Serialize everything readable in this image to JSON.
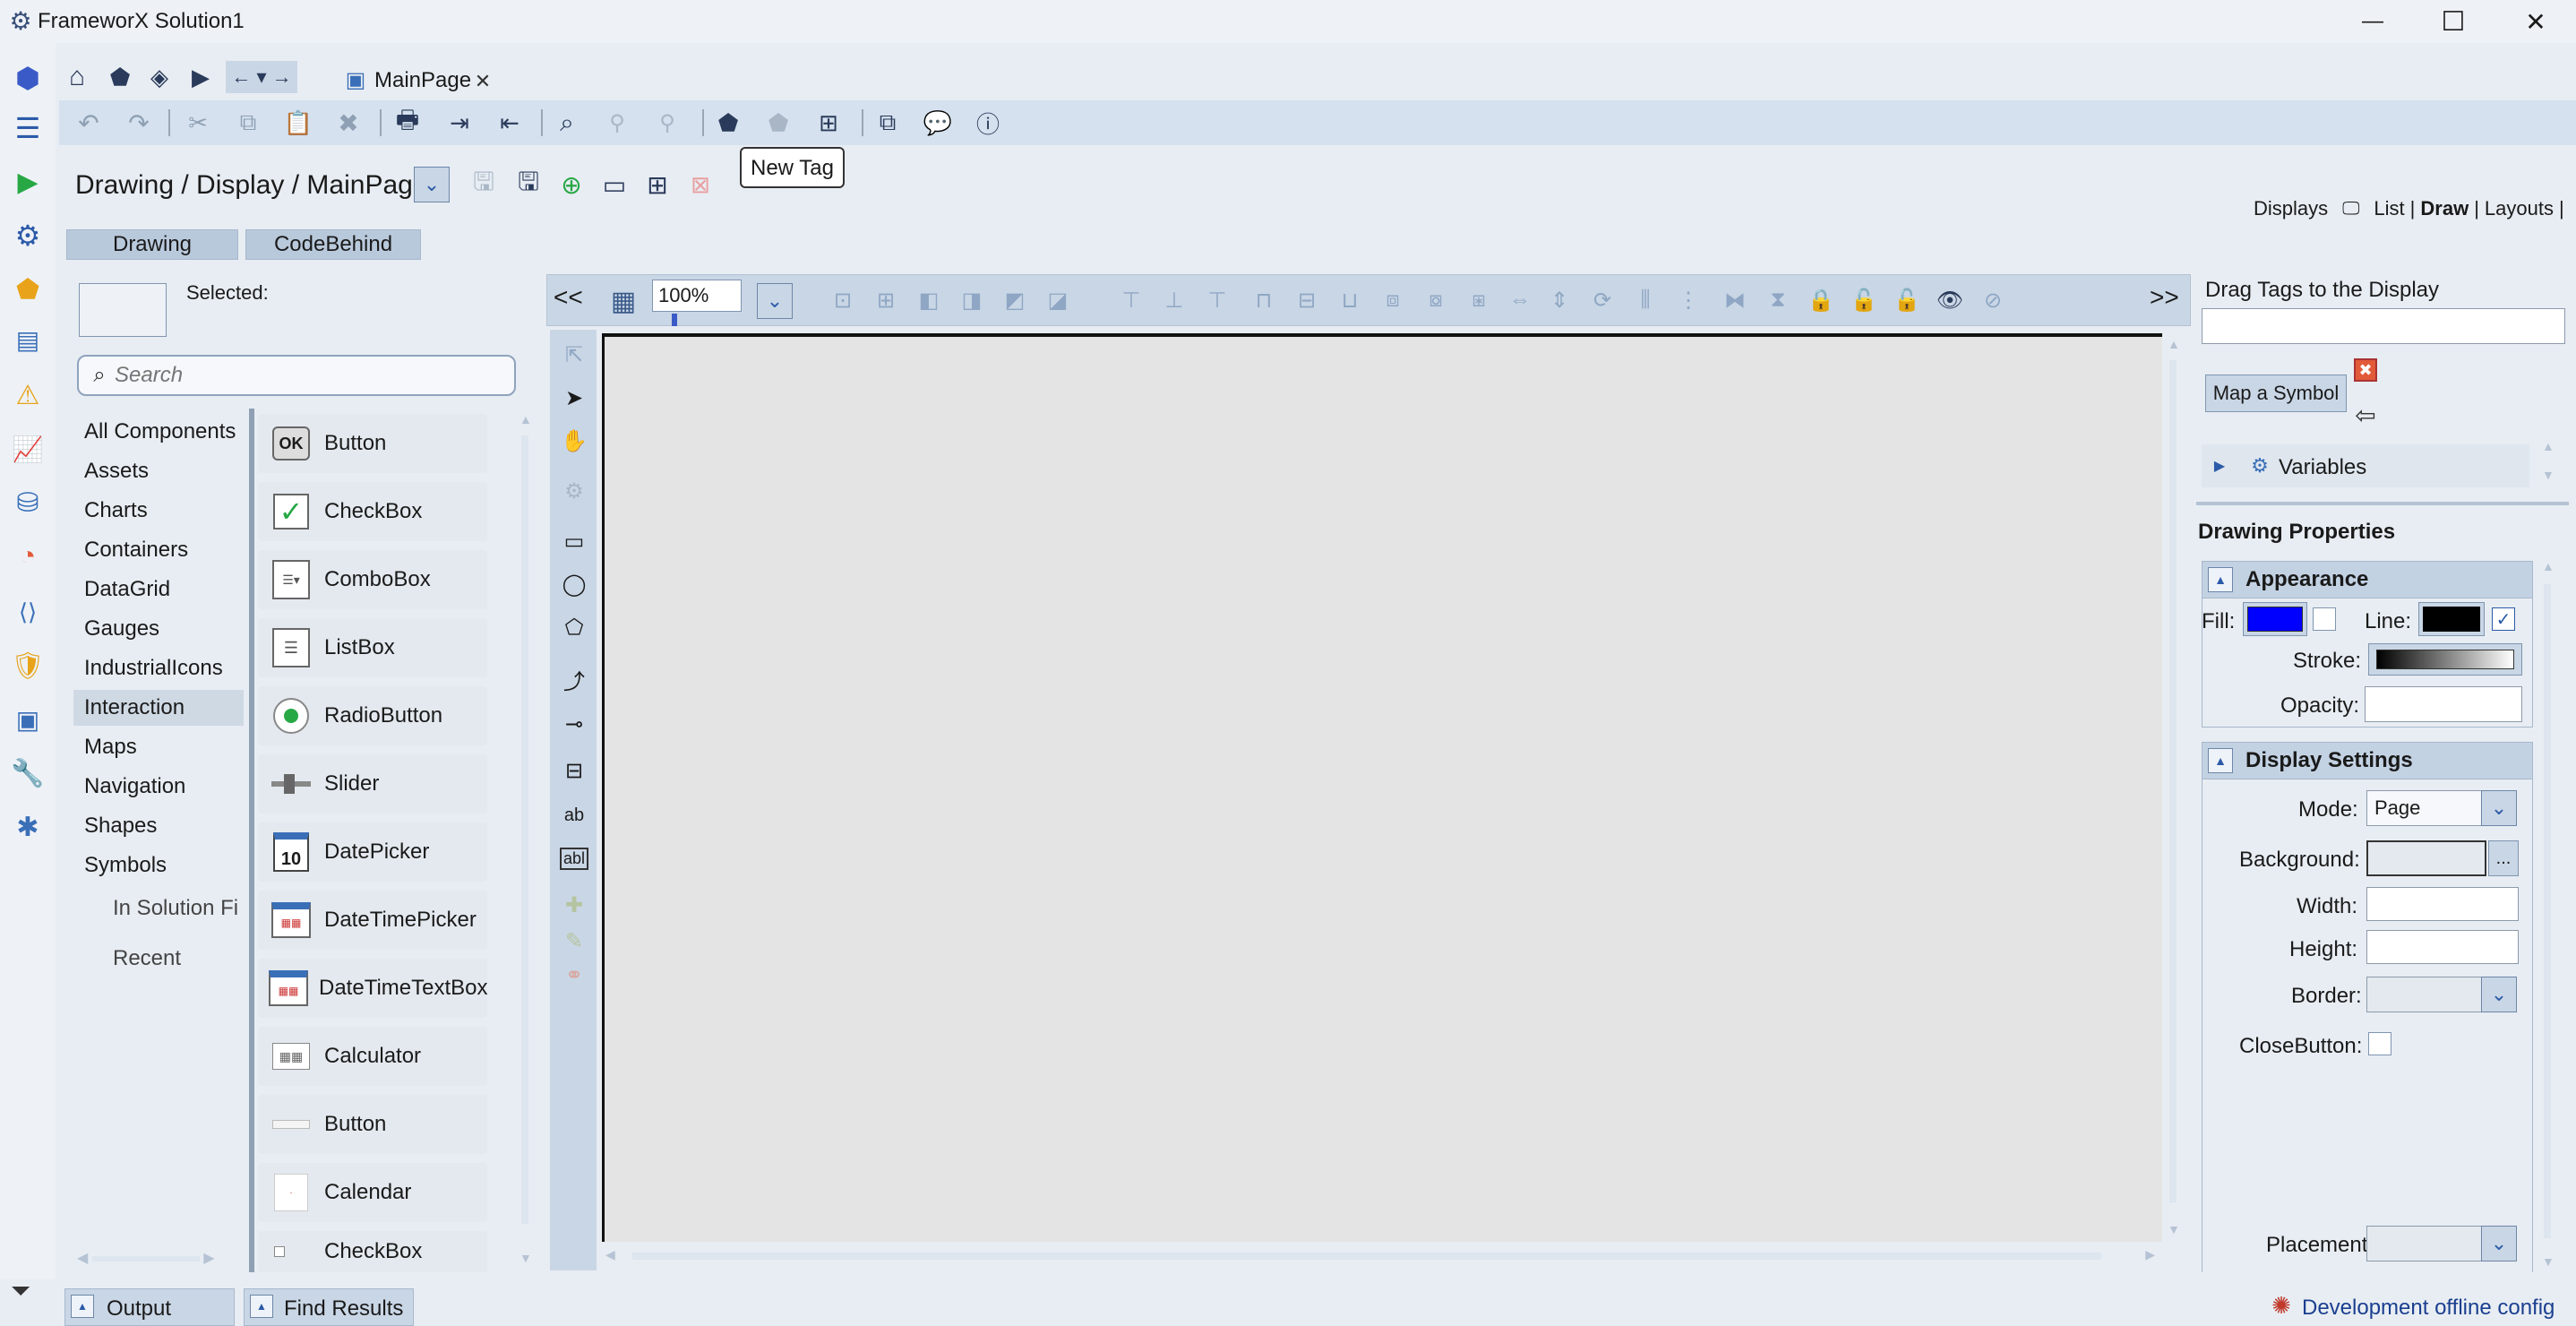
{
  "app": {
    "title": "FrameworX Solution1"
  },
  "window_controls": {
    "minimize": "—",
    "maximize": "☐",
    "close": "✕"
  },
  "document_tab": {
    "label": "MainPage",
    "close": "✕"
  },
  "tooltip": "New Tag",
  "breadcrumb": "Drawing / Display / MainPage",
  "view_switch": {
    "displays": "Displays",
    "list": "List",
    "draw": "Draw",
    "layouts": "Layouts",
    "sep": "|"
  },
  "editor_tabs": [
    "Drawing",
    "CodeBehind"
  ],
  "selected_label": "Selected:",
  "search": {
    "placeholder": "Search"
  },
  "categories": [
    "All Components",
    "Assets",
    "Charts",
    "Containers",
    "DataGrid",
    "Gauges",
    "IndustrialIcons",
    "Interaction",
    "Maps",
    "Navigation",
    "Shapes",
    "Symbols"
  ],
  "selected_category": "Interaction",
  "symbol_subitems": [
    "In Solution Fi",
    "Recent"
  ],
  "components": [
    {
      "label": "Button",
      "icon": "ok-button-icon"
    },
    {
      "label": "CheckBox",
      "icon": "checkbox-icon"
    },
    {
      "label": "ComboBox",
      "icon": "combobox-icon"
    },
    {
      "label": "ListBox",
      "icon": "listbox-icon"
    },
    {
      "label": "RadioButton",
      "icon": "radiobutton-icon"
    },
    {
      "label": "Slider",
      "icon": "slider-icon"
    },
    {
      "label": "DatePicker",
      "icon": "datepicker-icon"
    },
    {
      "label": "DateTimePicker",
      "icon": "datetimepicker-icon"
    },
    {
      "label": "DateTimeTextBox",
      "icon": "datetimetextbox-icon"
    },
    {
      "label": "Calculator",
      "icon": "calculator-icon"
    },
    {
      "label": "Button",
      "icon": "small-button-icon"
    },
    {
      "label": "Calendar",
      "icon": "calendar-icon"
    },
    {
      "label": "CheckBox",
      "icon": "small-checkbox-icon"
    }
  ],
  "canvas_toolbar": {
    "collapse_left": "<<",
    "expand_right": ">>",
    "zoom": "100%"
  },
  "right_panel": {
    "drag_tags_title": "Drag Tags to the Display",
    "map_symbol_button": "Map a Symbol",
    "variables_label": "Variables",
    "drawing_properties": "Drawing Properties",
    "appearance": {
      "title": "Appearance",
      "fill_label": "Fill:",
      "fill_color": "#0000ff",
      "line_label": "Line:",
      "line_color": "#000000",
      "stroke_label": "Stroke:",
      "opacity_label": "Opacity:"
    },
    "display_settings": {
      "title": "Display Settings",
      "mode_label": "Mode:",
      "mode_value": "Page",
      "background_label": "Background:",
      "background_more": "...",
      "width_label": "Width:",
      "height_label": "Height:",
      "border_label": "Border:",
      "close_button_label": "CloseButton:",
      "placement_label": "Placement:"
    }
  },
  "bottom_tabs": [
    "Output",
    "Find Results"
  ],
  "status": {
    "text": "Development offline config"
  },
  "colors": {
    "accent": "#2b5aa8",
    "toolbar_bg": "#d5e1ee",
    "canvas_bg": "#e4e4e4",
    "sidebar_icon": "#3a6fb8"
  }
}
